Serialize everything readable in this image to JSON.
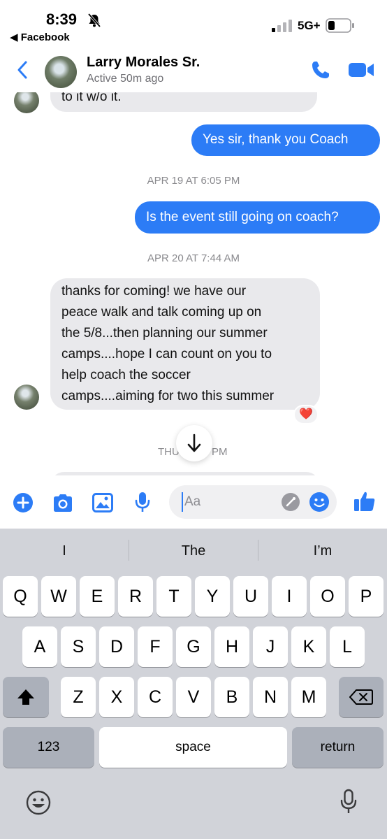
{
  "status_bar": {
    "time": "8:39",
    "back_app": "◀ Facebook",
    "network": "5G+"
  },
  "header": {
    "contact_name": "Larry Morales Sr.",
    "contact_status": "Active 50m ago"
  },
  "messages": [
    {
      "direction": "in",
      "text": "to it w/o it."
    },
    {
      "direction": "out",
      "text": "Yes sir, thank you Coach"
    },
    {
      "type": "timestamp",
      "text": "APR 19 AT 6:05 PM"
    },
    {
      "direction": "out",
      "text": "Is the event still going on coach?"
    },
    {
      "type": "timestamp",
      "text": "APR 20 AT 7:44 AM"
    },
    {
      "direction": "in",
      "lines": [
        "thanks for coming! we have our",
        "peace walk and talk coming up on",
        "the 5/8...then planning our summer",
        "camps....hope I can count on you to",
        "help coach the soccer",
        "camps....aiming for two this summer"
      ],
      "reaction": "❤️"
    },
    {
      "type": "timestamp",
      "text_left": "THU",
      "text_right": "PM"
    }
  ],
  "composer": {
    "placeholder": "Aa"
  },
  "keyboard": {
    "suggestions": [
      "I",
      "The",
      "I’m"
    ],
    "row1": [
      "Q",
      "W",
      "E",
      "R",
      "T",
      "Y",
      "U",
      "I",
      "O",
      "P"
    ],
    "row2": [
      "A",
      "S",
      "D",
      "F",
      "G",
      "H",
      "J",
      "K",
      "L"
    ],
    "row3": [
      "Z",
      "X",
      "C",
      "V",
      "B",
      "N",
      "M"
    ],
    "numbers_label": "123",
    "space_label": "space",
    "return_label": "return"
  },
  "colors": {
    "accent": "#2c7cf6",
    "incoming_bubble": "#e9e9ec",
    "keyboard_bg": "#d1d3d9"
  },
  "icons": [
    "bell-slash-icon",
    "signal-icon",
    "battery-icon",
    "back-chevron-icon",
    "phone-icon",
    "video-icon",
    "plus-icon",
    "camera-icon",
    "image-icon",
    "mic-icon",
    "sticker-icon",
    "emoji-icon",
    "like-icon",
    "arrow-down-icon",
    "shift-icon",
    "delete-icon",
    "emoji-keyboard-icon",
    "dictation-icon"
  ]
}
